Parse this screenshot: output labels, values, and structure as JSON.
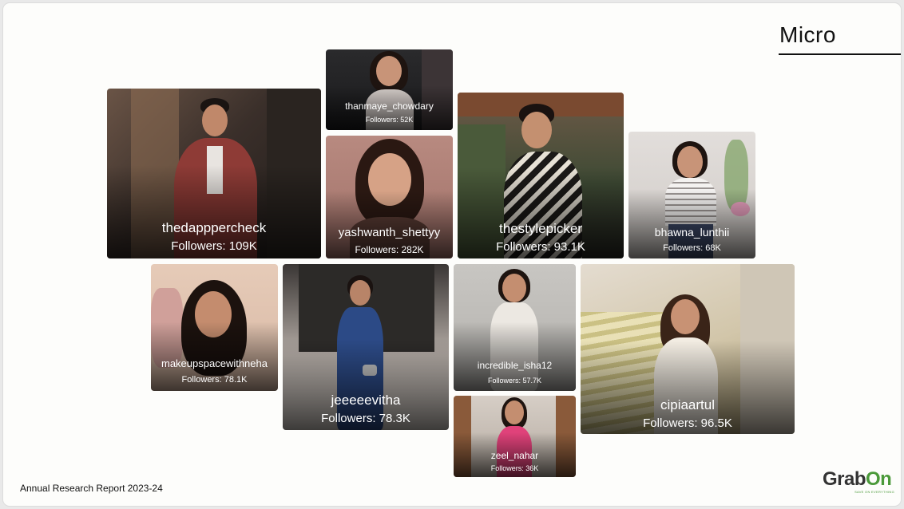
{
  "slide": {
    "title": "Micro",
    "footer": "Annual Research Report 2023-24",
    "logo": {
      "part1": "Grab",
      "part2": "On",
      "tagline": "SAVE ON EVERYTHING"
    }
  },
  "influencers": [
    {
      "handle": "thedapppercheck",
      "followers": "Followers: 109K"
    },
    {
      "handle": "thanmaye_chowdary",
      "followers": "Followers: 52K"
    },
    {
      "handle": "yashwanth_shettyy",
      "followers": "Followers: 282K"
    },
    {
      "handle": "thestylepicker",
      "followers": "Followers: 93.1K"
    },
    {
      "handle": "bhawna_lunthii",
      "followers": "Followers: 68K"
    },
    {
      "handle": "makeupspacewithneha",
      "followers": "Followers: 78.1K"
    },
    {
      "handle": "jeeeeevitha",
      "followers": "Followers: 78.3K"
    },
    {
      "handle": "incredible_isha12",
      "followers": "Followers: 57.7K"
    },
    {
      "handle": "zeel_nahar",
      "followers": "Followers: 36K"
    },
    {
      "handle": "cipiaartul",
      "followers": "Followers: 96.5K"
    }
  ]
}
